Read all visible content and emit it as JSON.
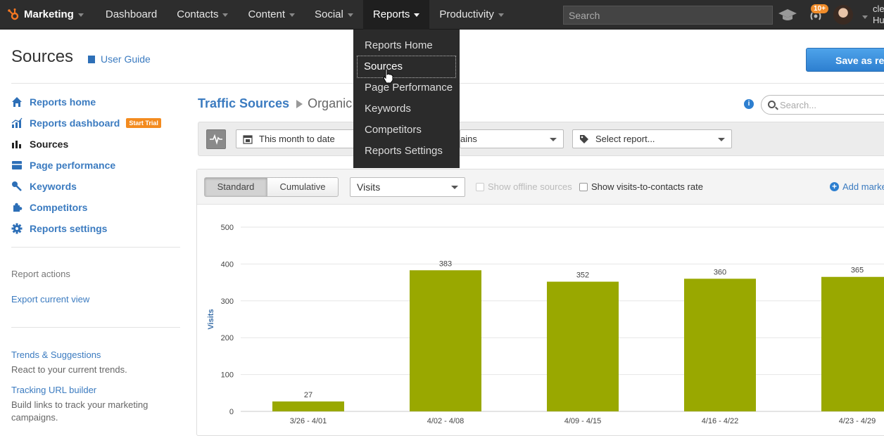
{
  "topnav": {
    "brand": "Marketing",
    "items": [
      "Dashboard",
      "Contacts",
      "Content",
      "Social",
      "Reports",
      "Productivity"
    ],
    "search_placeholder": "Search",
    "notification_count": "10+",
    "user_line1": "cle",
    "user_line2": "Hu"
  },
  "reports_menu": {
    "items": [
      "Reports Home",
      "Sources",
      "Page Performance",
      "Keywords",
      "Competitors",
      "Reports Settings"
    ],
    "selected": "Sources"
  },
  "page": {
    "title": "Sources",
    "user_guide": "User Guide",
    "save_button": "Save as re"
  },
  "sidebar": {
    "items": [
      {
        "label": "Reports home",
        "icon": "home-icon"
      },
      {
        "label": "Reports dashboard",
        "icon": "bar-chart-icon",
        "badge": "Start Trial"
      },
      {
        "label": "Sources",
        "icon": "bars-icon"
      },
      {
        "label": "Page performance",
        "icon": "page-icon"
      },
      {
        "label": "Keywords",
        "icon": "key-icon"
      },
      {
        "label": "Competitors",
        "icon": "puzzle-icon"
      },
      {
        "label": "Reports settings",
        "icon": "gear-icon"
      }
    ],
    "report_actions_label": "Report actions",
    "export_link": "Export current view",
    "trends_link": "Trends & Suggestions",
    "trends_desc": "React to your current trends.",
    "tracking_link": "Tracking URL builder",
    "tracking_desc": "Build links to track your marketing campaigns."
  },
  "main": {
    "breadcrumb_root": "Traffic Sources",
    "breadcrumb_current": "Organic",
    "search_placeholder": "Search...",
    "date_range": "This month to date",
    "domains_select": "ains",
    "report_select": "Select report...",
    "seg_standard": "Standard",
    "seg_cumulative": "Cumulative",
    "metric": "Visits",
    "show_offline": "Show offline sources",
    "show_rate": "Show visits-to-contacts rate",
    "add_marker": "Add marke"
  },
  "chart_data": {
    "type": "bar",
    "categories": [
      "3/26 - 4/01",
      "4/02 - 4/08",
      "4/09 - 4/15",
      "4/16 - 4/22",
      "4/23 - 4/29"
    ],
    "values": [
      27,
      383,
      352,
      360,
      365
    ],
    "ylabel": "Visits",
    "ylim": [
      0,
      500
    ],
    "yticks": [
      0,
      100,
      200,
      300,
      400,
      500
    ],
    "bar_color": "#99a800",
    "grid": true
  }
}
